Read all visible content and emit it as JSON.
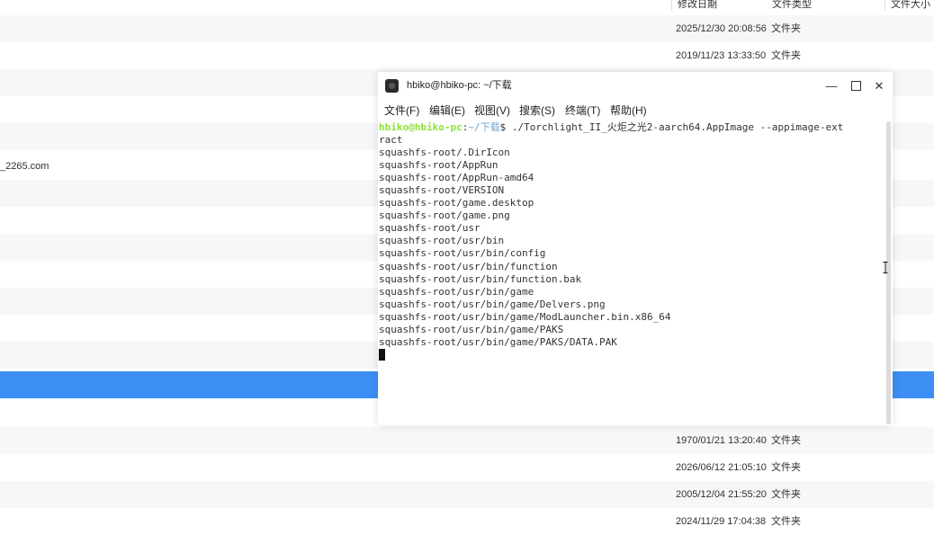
{
  "file_manager": {
    "columns": {
      "modified": "修改日期",
      "type": "文件类型",
      "size": "文件大小"
    },
    "rows_top": [
      {
        "date": "2025/12/30 20:08:56",
        "type": "文件夹"
      },
      {
        "date": "2019/11/23 13:33:50",
        "type": "文件夹"
      }
    ],
    "partial_name": "_2265.com",
    "rows_bottom": [
      {
        "date": "1970/01/21 13:20:40",
        "type": "文件夹"
      },
      {
        "date": "2026/06/12 21:05:10",
        "type": "文件夹"
      },
      {
        "date": "2005/12/04 21:55:20",
        "type": "文件夹"
      },
      {
        "date": "2024/11/29 17:04:38",
        "type": "文件夹"
      }
    ],
    "selection_color": "#3d8ff5"
  },
  "terminal": {
    "title": "hbiko@hbiko-pc: ~/下载",
    "menu": [
      "文件(F)",
      "编辑(E)",
      "视图(V)",
      "搜索(S)",
      "终端(T)",
      "帮助(H)"
    ],
    "prompt_user": "hbiko@hbiko-pc",
    "prompt_sep": ":",
    "prompt_path": "~/下载",
    "prompt_symbol": "$ ",
    "command": "./Torchlight_II_火炬之光2-aarch64.AppImage --appimage-ext",
    "command_cont": "ract",
    "output": [
      "squashfs-root/.DirIcon",
      "squashfs-root/AppRun",
      "squashfs-root/AppRun-amd64",
      "squashfs-root/VERSION",
      "squashfs-root/game.desktop",
      "squashfs-root/game.png",
      "squashfs-root/usr",
      "squashfs-root/usr/bin",
      "squashfs-root/usr/bin/config",
      "squashfs-root/usr/bin/function",
      "squashfs-root/usr/bin/function.bak",
      "squashfs-root/usr/bin/game",
      "squashfs-root/usr/bin/game/Delvers.png",
      "squashfs-root/usr/bin/game/ModLauncher.bin.x86_64",
      "squashfs-root/usr/bin/game/PAKS",
      "squashfs-root/usr/bin/game/PAKS/DATA.PAK"
    ],
    "colors": {
      "prompt_user": "#8ae234",
      "prompt_path": "#6ea6d6"
    }
  }
}
